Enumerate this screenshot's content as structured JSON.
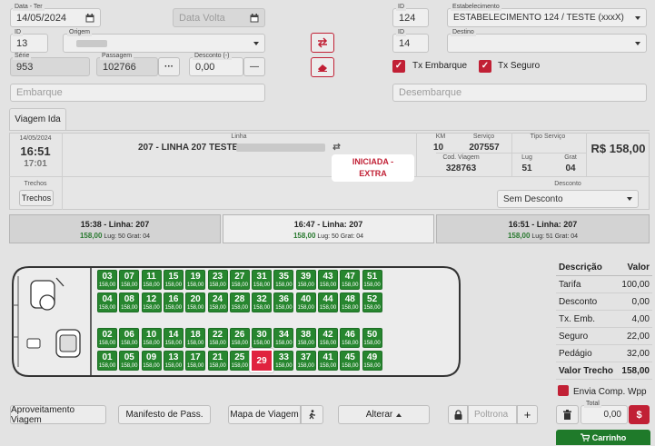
{
  "form": {
    "data_ter_label": "Data - Ter",
    "data_ter_value": "14/05/2024",
    "data_volta_placeholder": "Data Volta",
    "id_left_label": "ID",
    "id_left_value": "13",
    "origem_label": "Origem",
    "origem_value": "",
    "serie_label": "Série",
    "serie_value": "953",
    "passagem_label": "Passagem",
    "passagem_value": "102766",
    "desconto_label": "Desconto (-)",
    "desconto_value": "0,00",
    "embarque_placeholder": "Embarque",
    "id_top_label": "ID",
    "id_top_value": "124",
    "estabelecimento_label": "Estabelecimento",
    "estabelecimento_value": "ESTABELECIMENTO 124 / TESTE (xxxX)",
    "id_right_label": "ID",
    "id_right_value": "14",
    "destino_label": "Destino",
    "destino_value": "",
    "tx_embarque_label": "Tx Embarque",
    "tx_seguro_label": "Tx Seguro",
    "desembarque_placeholder": "Desembarque",
    "ellipsis": "···",
    "minus": "—"
  },
  "tab": {
    "label": "Viagem Ida"
  },
  "trip_panel": {
    "date": "14/05/2024",
    "time": "16:51",
    "time2": "17:01",
    "linha_label": "Linha",
    "linha_value": "207 - LINHA 207 TESTE -",
    "km_label": "KM",
    "km_value": "10",
    "servico_label": "Serviço",
    "servico_value": "207557",
    "tipo_servico_label": "Tipo Serviço",
    "price": "R$ 158,00",
    "status_line1": "INICIADA -",
    "status_line2": "EXTRA",
    "cod_viagem_label": "Cod. Viagem",
    "cod_viagem_value": "328763",
    "lug_label": "Lug",
    "lug_value": "51",
    "grat_label": "Grat",
    "grat_value": "04",
    "trechos_label": "Trechos",
    "trechos_button": "Trechos",
    "desconto_label": "Desconto",
    "desconto_value": "Sem Desconto"
  },
  "trips": [
    {
      "title": "15:38 - Linha: 207",
      "price": "158,00",
      "info": "Lug: 50 Grat: 04"
    },
    {
      "title": "16:47 - Linha: 207",
      "price": "158,00",
      "info": "Lug: 50 Grat: 04"
    },
    {
      "title": "16:51 - Linha: 207",
      "price": "158,00",
      "info": "Lug: 51 Grat: 04"
    }
  ],
  "seat_price": "158,00",
  "seats": {
    "row1": [
      "03",
      "07",
      "11",
      "15",
      "19",
      "23",
      "27",
      "31",
      "35",
      "39",
      "43",
      "47",
      "51"
    ],
    "row2": [
      "04",
      "08",
      "12",
      "16",
      "20",
      "24",
      "28",
      "32",
      "36",
      "40",
      "44",
      "48",
      "52"
    ],
    "row3": [
      "02",
      "06",
      "10",
      "14",
      "18",
      "22",
      "26",
      "30",
      "34",
      "38",
      "42",
      "46",
      "50"
    ],
    "row4": [
      "01",
      "05",
      "09",
      "13",
      "17",
      "21",
      "25",
      "29",
      "33",
      "37",
      "41",
      "45",
      "49"
    ],
    "selected": "29"
  },
  "summary": {
    "h1": "Descrição",
    "h2": "Valor",
    "rows": [
      {
        "k": "Tarifa",
        "v": "100,00"
      },
      {
        "k": "Desconto",
        "v": "0,00"
      },
      {
        "k": "Tx. Emb.",
        "v": "4,00"
      },
      {
        "k": "Seguro",
        "v": "22,00"
      },
      {
        "k": "Pedágio",
        "v": "32,00"
      },
      {
        "k": "Valor Trecho",
        "v": "158,00"
      }
    ],
    "envia_label": "Envia Comp. Wpp",
    "total_label": "Total",
    "total_value": "0,00",
    "carrinho": "Carrinho"
  },
  "bottom": {
    "aproveitamento": "Aproveitamento Viagem",
    "manifesto": "Manifesto de Pass.",
    "mapa": "Mapa de Viagem",
    "alterar": "Alterar",
    "poltrona_placeholder": "Poltrona",
    "plus": "+"
  },
  "colors": {
    "accent": "#c12035",
    "seat_free": "#27862f",
    "seat_selected": "#e0223f",
    "status_text": "#c12035"
  }
}
